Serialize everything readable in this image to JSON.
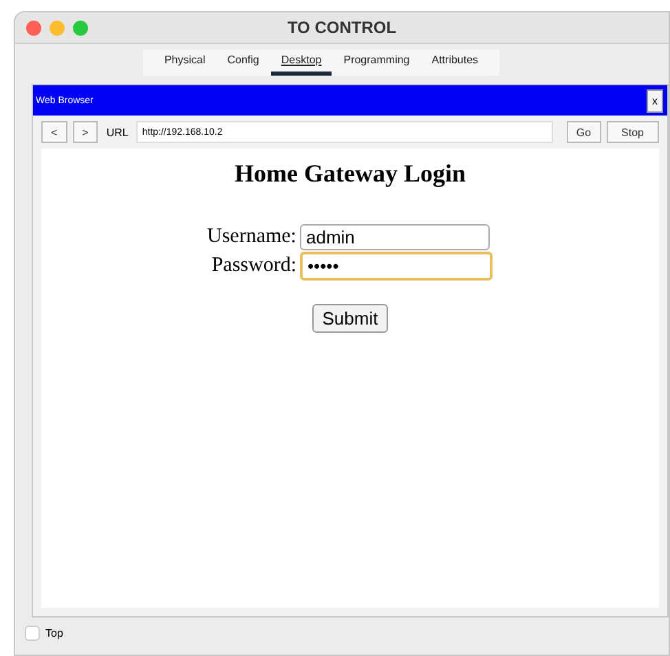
{
  "window": {
    "title": "TO CONTROL"
  },
  "tabs": [
    {
      "label": "Physical",
      "selected": false
    },
    {
      "label": "Config",
      "selected": false
    },
    {
      "label": "Desktop",
      "selected": true
    },
    {
      "label": "Programming",
      "selected": false
    },
    {
      "label": "Attributes",
      "selected": false
    }
  ],
  "browser": {
    "title": "Web Browser",
    "close": "x",
    "back": "<",
    "forward": ">",
    "url_label": "URL",
    "url": "http://192.168.10.2",
    "go": "Go",
    "stop": "Stop"
  },
  "page": {
    "heading": "Home Gateway Login",
    "fields": [
      {
        "label": "Username:",
        "value": "admin",
        "focused": false
      },
      {
        "label": "Password:",
        "value": "•••••",
        "focused": true
      }
    ],
    "submit": "Submit"
  },
  "footer": {
    "label": "Top",
    "checked": false
  }
}
